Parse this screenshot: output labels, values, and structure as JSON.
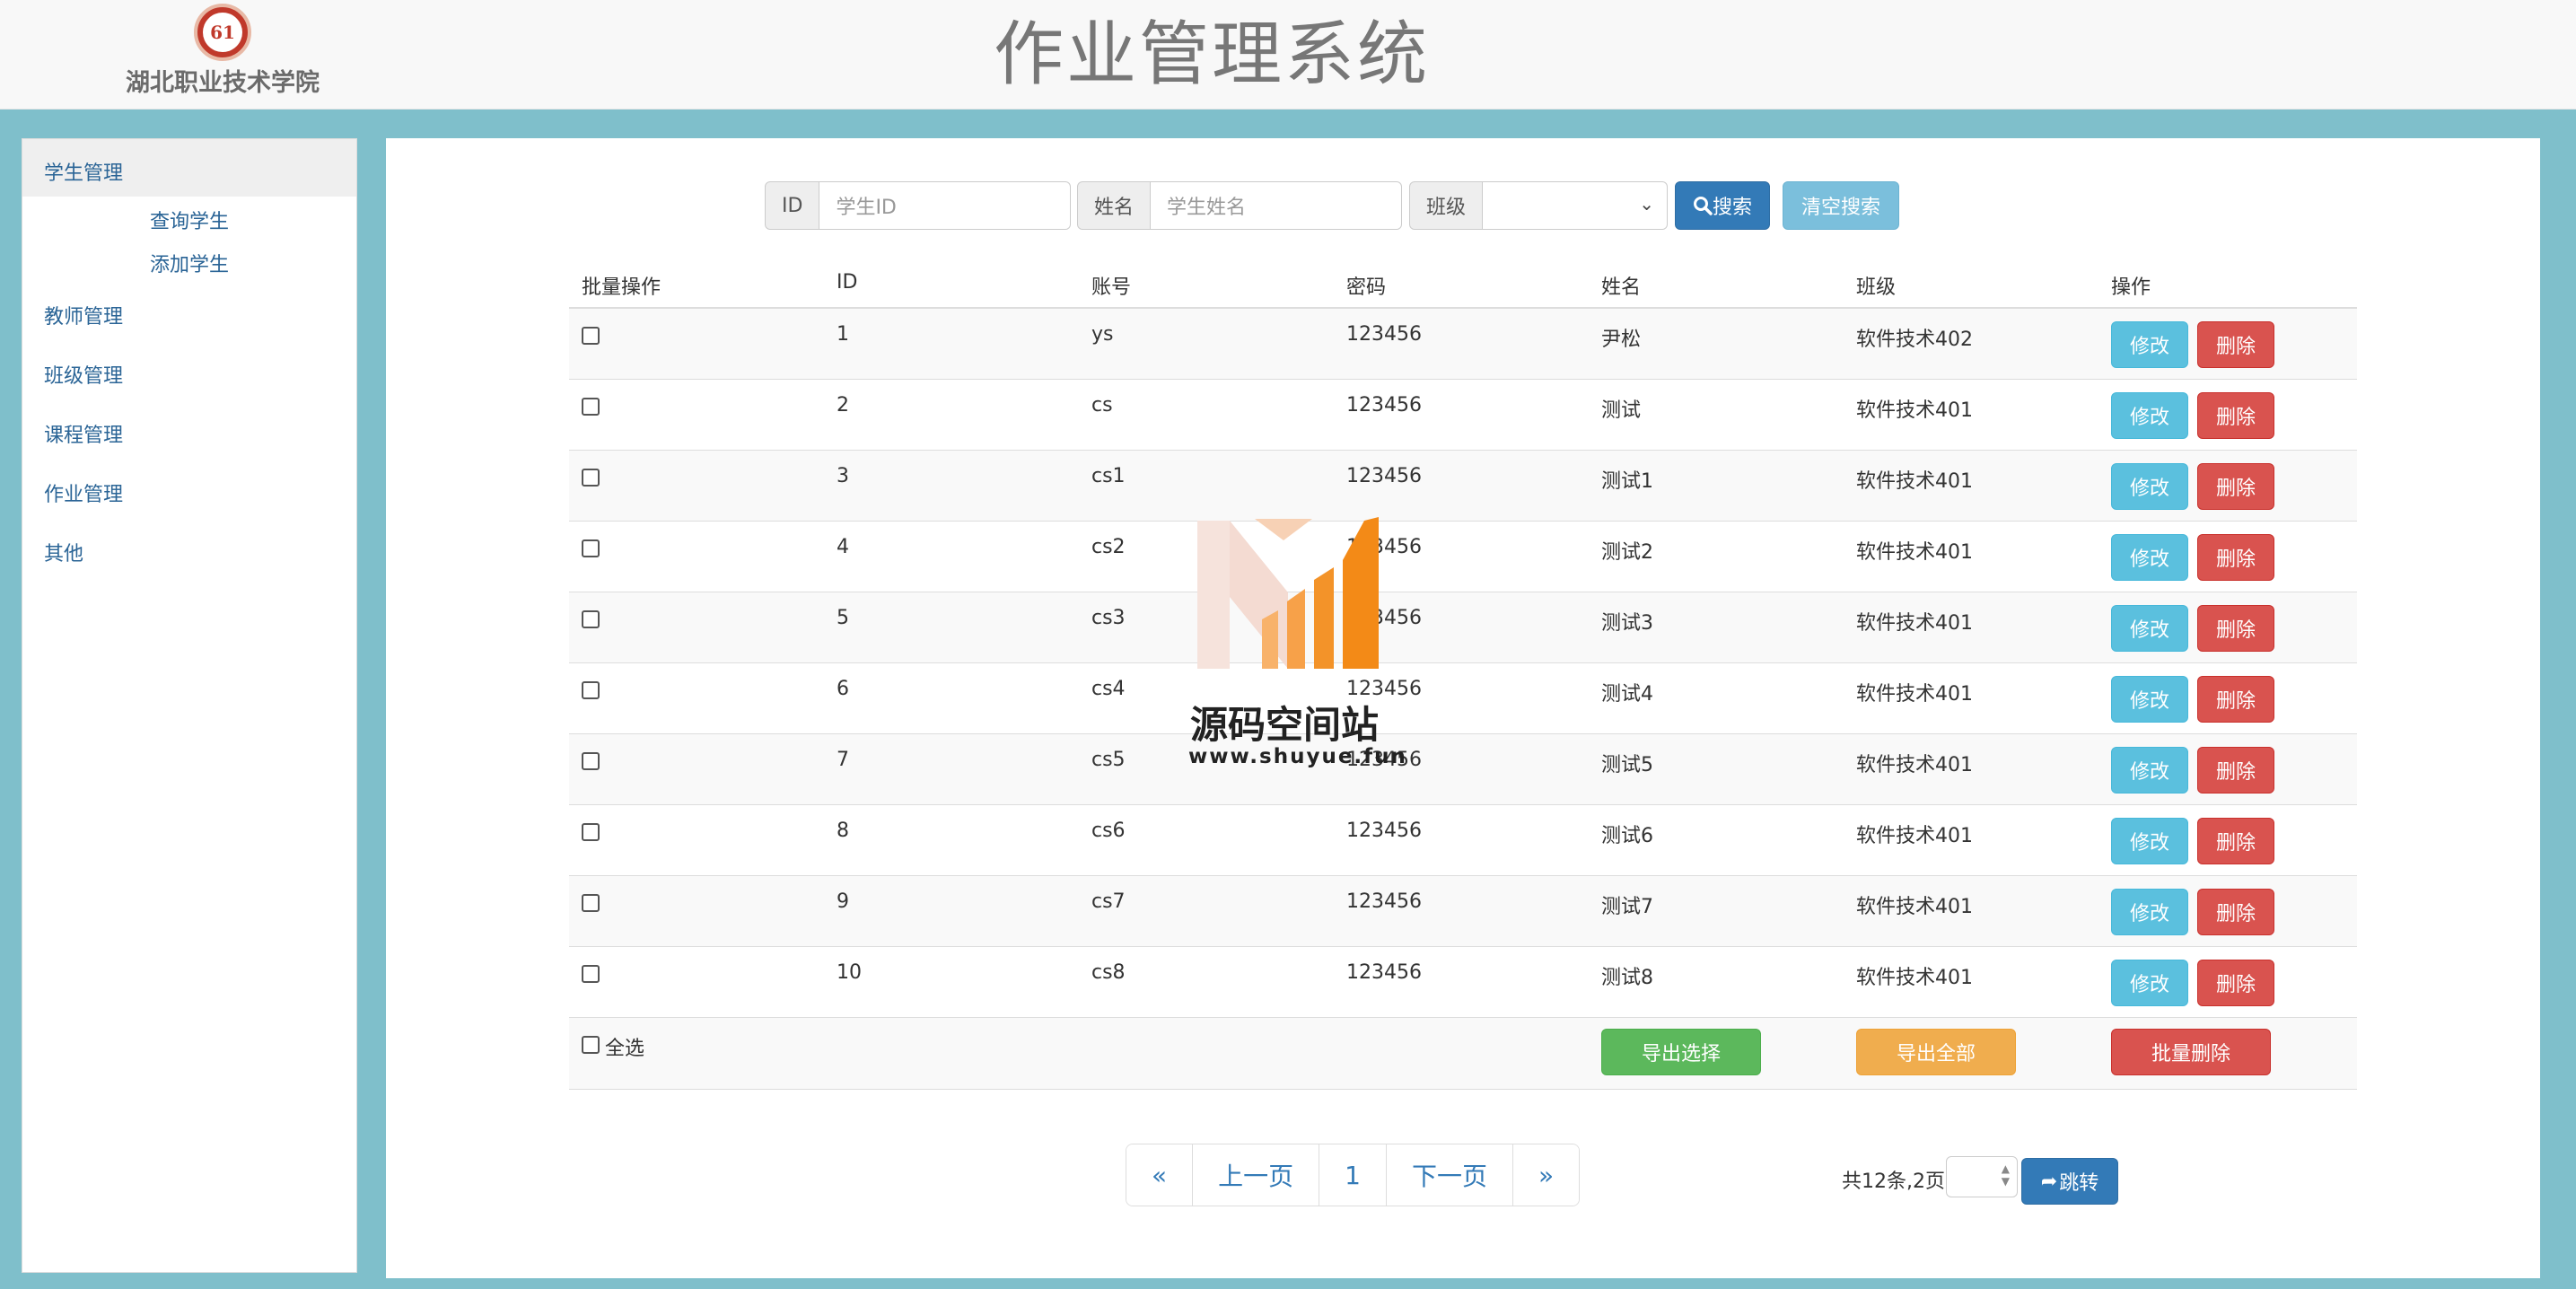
{
  "header": {
    "logo_text": "61",
    "school_name": "湖北职业技术学院",
    "system_title": "作业管理系统"
  },
  "sidebar": {
    "groups": [
      {
        "label": "学生管理",
        "subitems": [
          "查询学生",
          "添加学生"
        ]
      },
      {
        "label": "教师管理"
      },
      {
        "label": "班级管理"
      },
      {
        "label": "课程管理"
      },
      {
        "label": "作业管理"
      },
      {
        "label": "其他"
      }
    ]
  },
  "search": {
    "id_label": "ID",
    "id_placeholder": "学生ID",
    "name_label": "姓名",
    "name_placeholder": "学生姓名",
    "class_label": "班级",
    "class_value": "",
    "search_button": "搜索",
    "clear_button": "清空搜索"
  },
  "table": {
    "headers": [
      "批量操作",
      "ID",
      "账号",
      "密码",
      "姓名",
      "班级",
      "操作"
    ],
    "rows": [
      {
        "id": "1",
        "account": "ys",
        "password": "123456",
        "name": "尹松",
        "class": "软件技术402"
      },
      {
        "id": "2",
        "account": "cs",
        "password": "123456",
        "name": "测试",
        "class": "软件技术401"
      },
      {
        "id": "3",
        "account": "cs1",
        "password": "123456",
        "name": "测试1",
        "class": "软件技术401"
      },
      {
        "id": "4",
        "account": "cs2",
        "password": "123456",
        "name": "测试2",
        "class": "软件技术401"
      },
      {
        "id": "5",
        "account": "cs3",
        "password": "123456",
        "name": "测试3",
        "class": "软件技术401"
      },
      {
        "id": "6",
        "account": "cs4",
        "password": "123456",
        "name": "测试4",
        "class": "软件技术401"
      },
      {
        "id": "7",
        "account": "cs5",
        "password": "123456",
        "name": "测试5",
        "class": "软件技术401"
      },
      {
        "id": "8",
        "account": "cs6",
        "password": "123456",
        "name": "测试6",
        "class": "软件技术401"
      },
      {
        "id": "9",
        "account": "cs7",
        "password": "123456",
        "name": "测试7",
        "class": "软件技术401"
      },
      {
        "id": "10",
        "account": "cs8",
        "password": "123456",
        "name": "测试8",
        "class": "软件技术401"
      }
    ],
    "edit_label": "修改",
    "delete_label": "删除",
    "select_all_label": "全选",
    "export_selected": "导出选择",
    "export_all": "导出全部",
    "batch_delete": "批量删除"
  },
  "pagination": {
    "first": "«",
    "prev": "上一页",
    "current": "1",
    "next": "下一页",
    "last": "»",
    "total_text": "共12条,2页",
    "jump_button": "跳转"
  },
  "watermark": {
    "title": "源码空间站",
    "url": "www.shuyue.fun"
  }
}
